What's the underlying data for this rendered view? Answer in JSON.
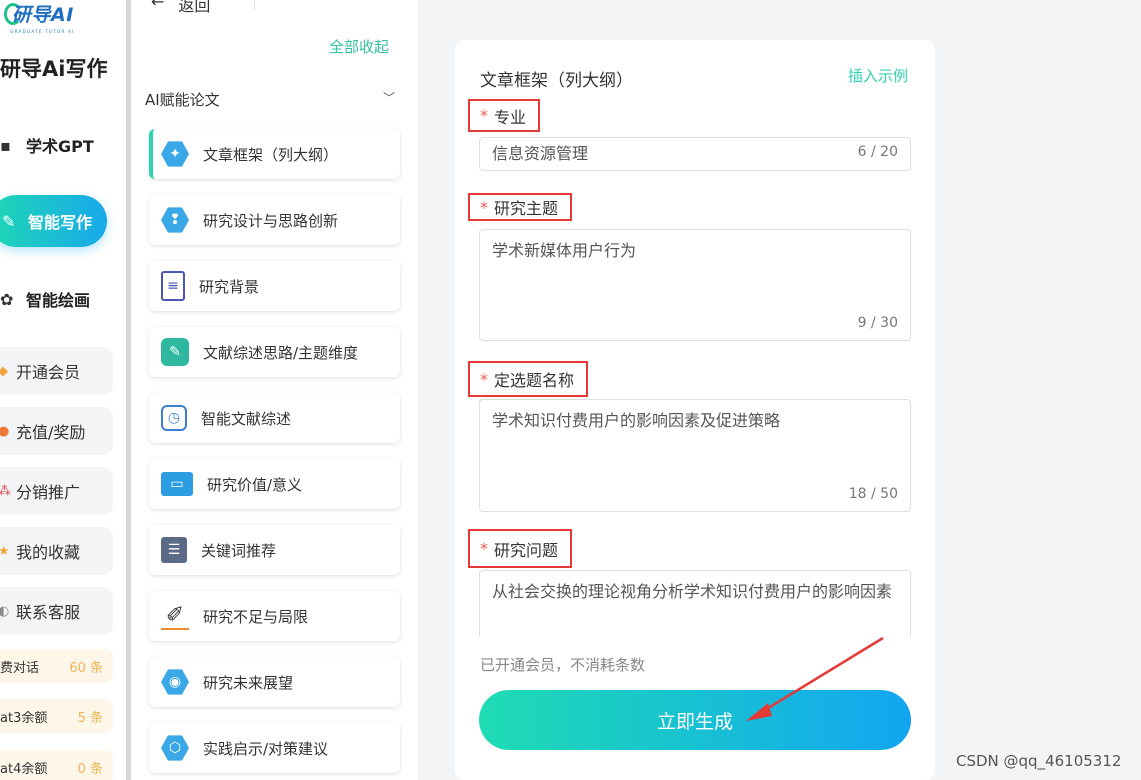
{
  "brand": {
    "logo_text": "研导AI",
    "logo_sub": "GRADUATE TUTOR AI",
    "title": "研导Ai写作"
  },
  "nav": [
    {
      "label": "学术GPT",
      "icon": "chat-icon"
    },
    {
      "label": "智能写作",
      "icon": "pen-icon"
    },
    {
      "label": "智能绘画",
      "icon": "palette-icon"
    }
  ],
  "side_buttons": [
    {
      "label": "开通会员",
      "icon": "diamond-icon"
    },
    {
      "label": "充值/奖励",
      "icon": "wallet-icon"
    },
    {
      "label": "分销推广",
      "icon": "share-icon"
    },
    {
      "label": "我的收藏",
      "icon": "star-icon"
    },
    {
      "label": "联系客服",
      "icon": "headset-icon"
    }
  ],
  "quotas": [
    {
      "label": "费对话",
      "value": "60 条"
    },
    {
      "label": "at3余额",
      "value": "5 条"
    },
    {
      "label": "at4余额",
      "value": "0 条"
    }
  ],
  "tool_col": {
    "back": "返回",
    "collapse_all": "全部收起",
    "section": "AI赋能论文"
  },
  "tools": [
    {
      "label": "文章框架（列大纲）",
      "icon": "outline-icon",
      "active": true
    },
    {
      "label": "研究设计与思路创新",
      "icon": "lightbulb-icon"
    },
    {
      "label": "研究背景",
      "icon": "document-icon"
    },
    {
      "label": "文献综述思路/主题维度",
      "icon": "whiteboard-icon"
    },
    {
      "label": "智能文献综述",
      "icon": "calendar-clock-icon"
    },
    {
      "label": "研究价值/意义",
      "icon": "laptop-icon"
    },
    {
      "label": "关键词推荐",
      "icon": "layers-icon"
    },
    {
      "label": "研究不足与局限",
      "icon": "pencil-icon"
    },
    {
      "label": "研究未来展望",
      "icon": "eye-icon"
    },
    {
      "label": "实践启示/对策建议",
      "icon": "hexagon-icon"
    }
  ],
  "form": {
    "title": "文章框架（列大纲）",
    "insert_example": "插入示例",
    "fields": [
      {
        "label": "专业",
        "value": "信息资源管理",
        "counter": "6 / 20"
      },
      {
        "label": "研究主题",
        "value": "学术新媒体用户行为",
        "counter": "9 / 30"
      },
      {
        "label": "定选题名称",
        "value": "学术知识付费用户的影响因素及促进策略",
        "counter": "18 / 50"
      },
      {
        "label": "研究问题",
        "value": "从社会交换的理论视角分析学术知识付费用户的影响因素"
      }
    ],
    "required_mark": "*",
    "member_note": "已开通会员，不消耗条数",
    "generate_button": "立即生成"
  },
  "watermark": "CSDN @qq_46105312",
  "colors": {
    "accent": "#2fd2b2",
    "gradient_start": "#1fdcb3",
    "gradient_end": "#12a6f1",
    "highlight_box": "#e53935"
  }
}
